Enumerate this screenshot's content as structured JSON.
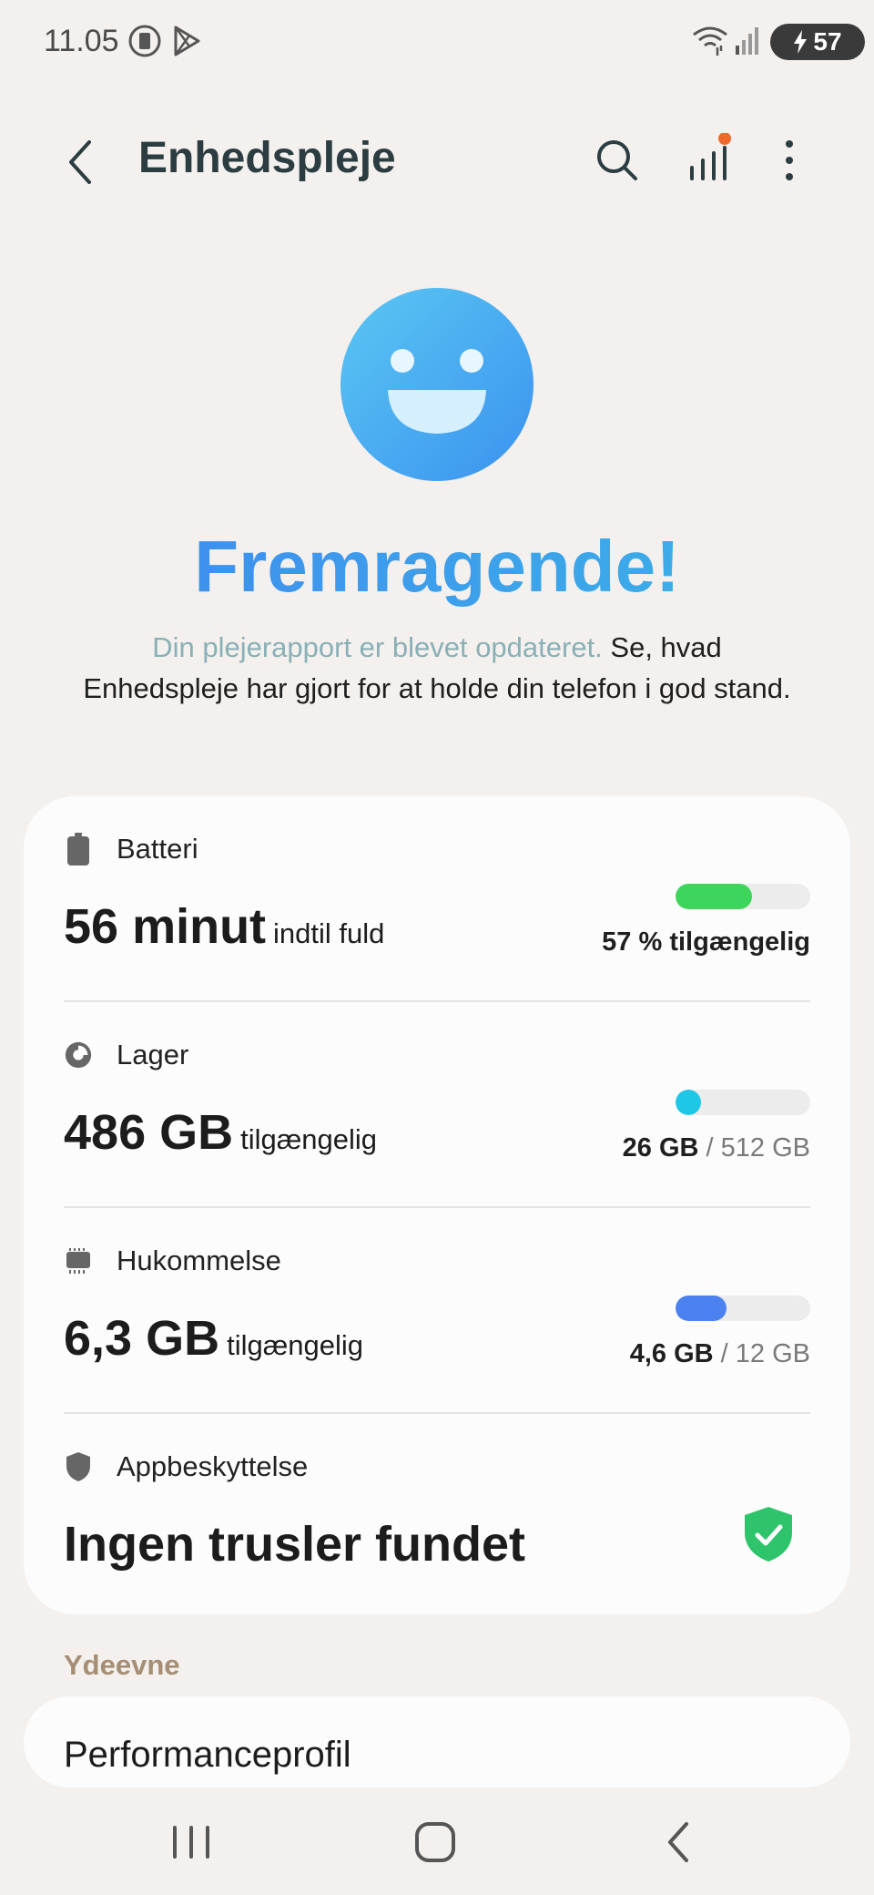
{
  "status_bar": {
    "time": "11.05",
    "battery_level": "57",
    "icons": [
      "screen-record-icon",
      "play-store-icon",
      "wifi-icon",
      "signal-icon",
      "charging-icon"
    ]
  },
  "app_bar": {
    "title": "Enhedspleje",
    "icons": [
      "back-icon",
      "search-icon",
      "stats-icon",
      "more-vert-icon"
    ],
    "notification_dot_color": "#ee6a2c"
  },
  "hero": {
    "status_title": "Fremragende!",
    "link_text": "Din plejerapport er blevet opdateret.",
    "body_text": " Se, hvad Enhedspleje har gjort for at holde din telefon i god stand."
  },
  "battery": {
    "label": "Batteri",
    "value": "56 minut",
    "suffix": "indtil fuld",
    "right_text": "57 % tilgængelig",
    "level_percent": 57,
    "color": "#3dd55b"
  },
  "storage": {
    "label": "Lager",
    "value": "486 GB",
    "suffix": "tilgængelig",
    "used": "26 GB",
    "separator": " / ",
    "total": "512 GB",
    "used_fraction": 0.05,
    "color": "#1ec7e6"
  },
  "memory": {
    "label": "Hukommelse",
    "value": "6,3 GB",
    "suffix": "tilgængelig",
    "used": "4,6 GB",
    "separator": " / ",
    "total": "12 GB",
    "used_fraction": 0.38,
    "color": "#4b82f0"
  },
  "app_protection": {
    "label": "Appbeskyttelse",
    "value": "Ingen trusler fundet",
    "status_color": "#2ec46c"
  },
  "performance": {
    "section_header": "Ydeevne",
    "item_title": "Performanceprofil"
  },
  "nav_bar": {
    "icons": [
      "recent-apps-icon",
      "home-icon",
      "back-icon"
    ]
  }
}
